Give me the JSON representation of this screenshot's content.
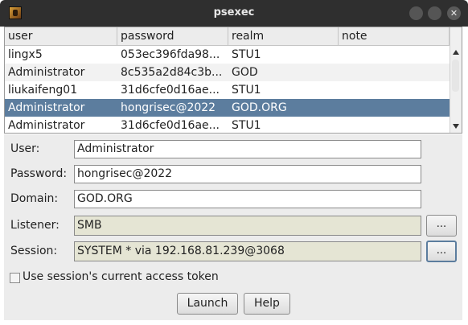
{
  "window": {
    "title": "psexec"
  },
  "table": {
    "columns": [
      "user",
      "password",
      "realm",
      "note"
    ],
    "rows": [
      {
        "user": "lingx5",
        "password": "053ec396fda98...",
        "realm": "STU1",
        "note": ""
      },
      {
        "user": "Administrator",
        "password": "8c535a2d84c3b...",
        "realm": "GOD",
        "note": ""
      },
      {
        "user": "liukaifeng01",
        "password": "31d6cfe0d16ae...",
        "realm": "STU1",
        "note": ""
      },
      {
        "user": "Administrator",
        "password": "hongrisec@2022",
        "realm": "GOD.ORG",
        "note": ""
      },
      {
        "user": "Administrator",
        "password": "31d6cfe0d16ae...",
        "realm": "STU1",
        "note": ""
      }
    ]
  },
  "form": {
    "user_label": "User:",
    "user_value": "Administrator",
    "password_label": "Password:",
    "password_value": "hongrisec@2022",
    "domain_label": "Domain:",
    "domain_value": "GOD.ORG",
    "listener_label": "Listener:",
    "listener_value": "SMB",
    "session_label": "Session:",
    "session_value": "SYSTEM * via  192.168.81.239@3068",
    "browse_label": "...",
    "token_checkbox_label": "Use session's current access token",
    "launch_label": "Launch",
    "help_label": "Help"
  },
  "colors": {
    "selection": "#5c7d9e",
    "titlebar": "#2f2f2f"
  }
}
